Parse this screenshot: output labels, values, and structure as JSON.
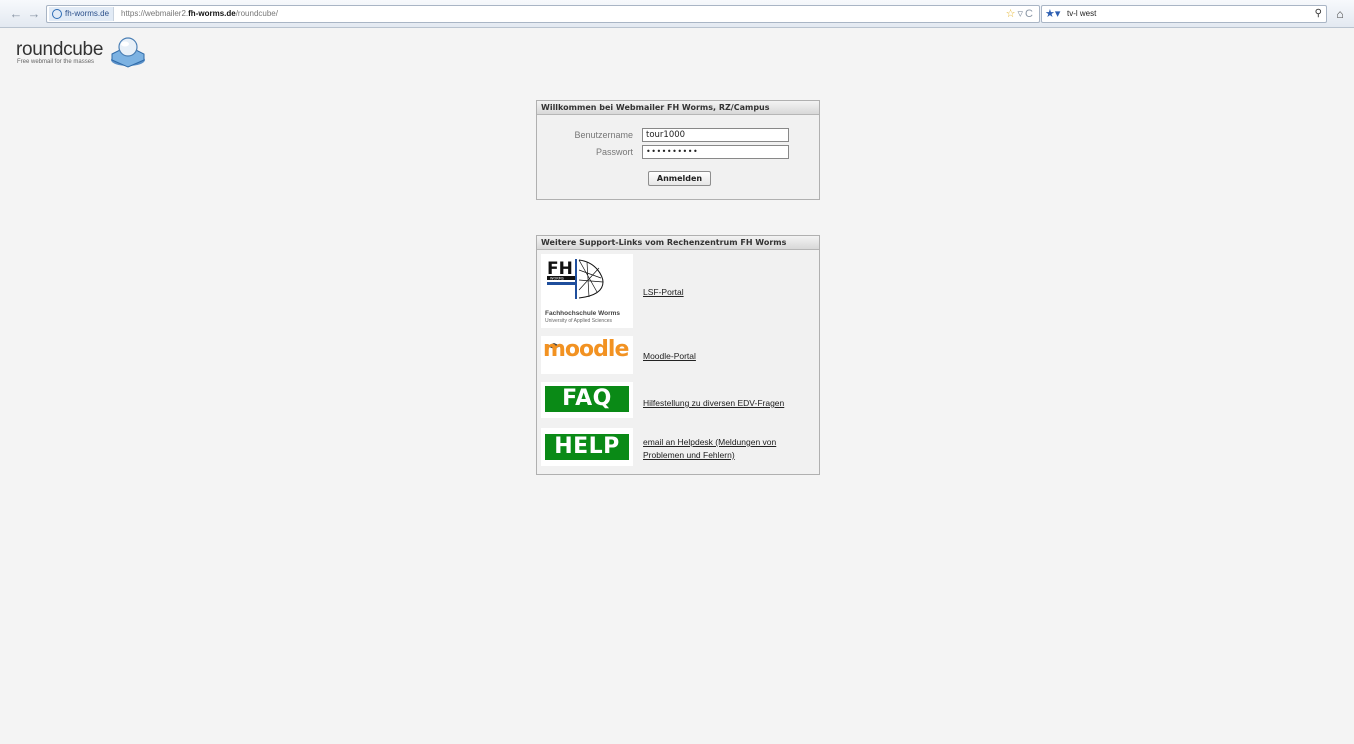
{
  "browser": {
    "site_identity": "fh-worms.de",
    "url_prefix": "https://webmailer2.",
    "url_domain": "fh-worms.de",
    "url_path": "/roundcube/",
    "search_text": "tv-l west"
  },
  "logo": {
    "name": "roundcube",
    "tagline": "Free webmail for the masses"
  },
  "login": {
    "title": "Willkommen bei Webmailer FH Worms, RZ/Campus",
    "username_label": "Benutzername",
    "username_value": "tour1000",
    "password_label": "Passwort",
    "password_value": "••••••••••",
    "submit_label": "Anmelden"
  },
  "support": {
    "title": "Weitere Support-Links vom Rechenzentrum FH Worms",
    "fh_logo_title": "Fachhochschule Worms",
    "fh_logo_subtitle": "University of Applied Sciences",
    "fh_logo_letters": "FH",
    "fh_logo_small": "WORMS",
    "moodle_logo": "moodle",
    "faq_logo": "FAQ",
    "help_logo": "HELP",
    "links": [
      {
        "label": "LSF-Portal"
      },
      {
        "label": "Moodle-Portal"
      },
      {
        "label": "Hilfestellung zu diversen EDV-Fragen"
      },
      {
        "label_line1": "email an Helpdesk (Meldungen von",
        "label_line2": "Problemen und Fehlern)"
      }
    ]
  },
  "colors": {
    "page_bg": "#f4f4f4",
    "moodle_orange": "#f29222",
    "badge_green": "#0a8a16",
    "fh_blue": "#1f4e9c"
  }
}
